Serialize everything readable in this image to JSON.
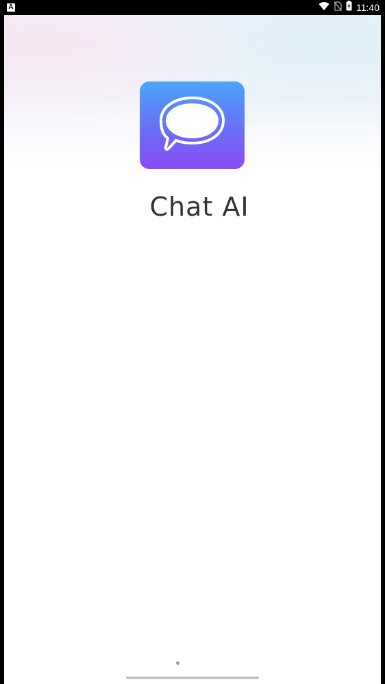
{
  "status_bar": {
    "notification_icon": "A",
    "icons": [
      "wifi-icon",
      "no-sim-icon",
      "battery-charging-icon"
    ],
    "time": "11:40"
  },
  "app": {
    "name": "Chat AI",
    "logo_icon": "chat-bubble-icon"
  },
  "colors": {
    "logo_gradient_top": "#4aa6f8",
    "logo_gradient_bottom": "#8a4cf5",
    "title_text": "#333333"
  }
}
